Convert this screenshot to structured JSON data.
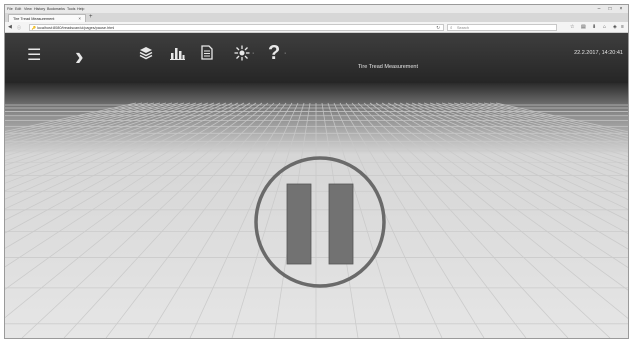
{
  "browser": {
    "menu": [
      "File",
      "Edit",
      "View",
      "History",
      "Bookmarks",
      "Tools",
      "Help"
    ],
    "window_controls": [
      "–",
      "□",
      "×"
    ],
    "tab": {
      "title": "Tire Tread Measurement",
      "close": "×"
    },
    "new_tab": "+",
    "nav": {
      "back": "◀",
      "info": "ⓘ",
      "key": "🔑"
    },
    "url": "localhost:8080/treadscan/ui/pages/pause.html",
    "reload": "↻",
    "search_placeholder": "Search",
    "toolbar_icons": [
      "star-icon",
      "library-icon",
      "download-icon",
      "home-icon",
      "pocket-icon",
      "menu-icon"
    ]
  },
  "app": {
    "title": "Tire Tread Measurement",
    "datetime": "22.2.2017, 14:20:41",
    "toolbar": {
      "menu": "☰",
      "next": "›",
      "layers": "layers-icon",
      "chart": "chart-icon",
      "document": "document-icon",
      "brightness": "✳",
      "help": "?",
      "dropdown_marker": "·"
    }
  },
  "main": {
    "state": "paused",
    "pause_icon": "pause-icon"
  },
  "colors": {
    "header_top": "#3e3e3e",
    "header_bottom": "#262626",
    "pause_bar": "#727272",
    "pause_ring": "#6a6a6a",
    "floor": "#e4e4e4",
    "grid": "#c9c9c9"
  }
}
